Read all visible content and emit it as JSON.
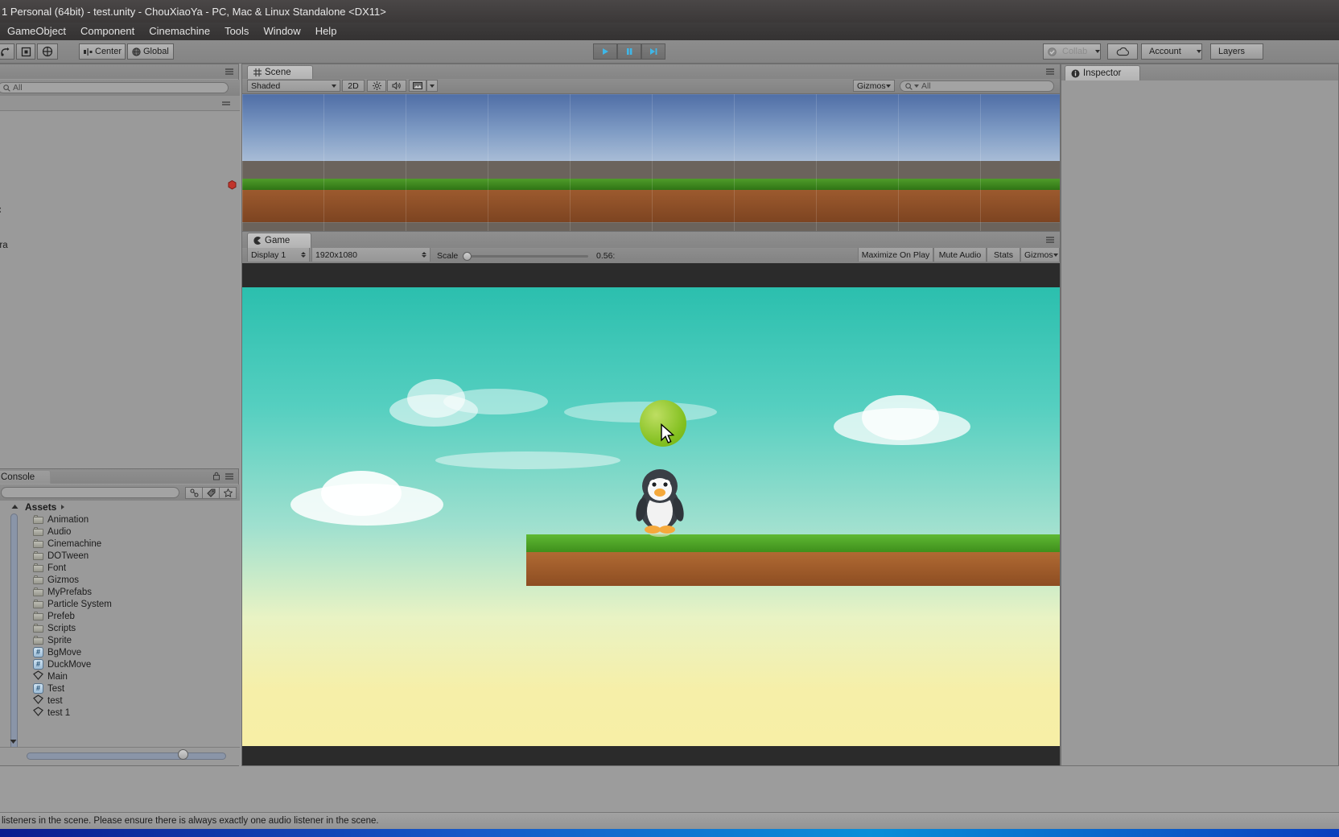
{
  "window": {
    "title": "1 Personal (64bit) - test.unity - ChouXiaoYa - PC, Mac & Linux Standalone <DX11>"
  },
  "menubar": {
    "items": [
      {
        "label": "GameObject"
      },
      {
        "label": "Component"
      },
      {
        "label": "Cinemachine"
      },
      {
        "label": "Tools"
      },
      {
        "label": "Window"
      },
      {
        "label": "Help"
      }
    ]
  },
  "toolbar": {
    "pivot_label": "Center",
    "space_label": "Global",
    "play_label": "play-button",
    "pause_label": "pause-button",
    "step_label": "step-button",
    "collab_label": "Collab",
    "cloud_label": "cloud-button",
    "account_label": "Account",
    "layers_label": "Layers"
  },
  "inspector": {
    "tab_label": "Inspector"
  },
  "scene": {
    "tab_label": "Scene",
    "draw_mode": "Shaded",
    "mode_2d": "2D",
    "gizmos_label": "Gizmos",
    "search_placeholder": "All"
  },
  "game": {
    "tab_label": "Game",
    "display": "Display 1",
    "resolution": "1920x1080",
    "scale_label": "Scale",
    "scale_value": "0.56:",
    "maximize_label": "Maximize On Play",
    "mute_label": "Mute Audio",
    "stats_label": "Stats",
    "gizmos_label": "Gizmos"
  },
  "console": {
    "tab_label": "Console",
    "search_placeholder": ""
  },
  "project": {
    "root_label": "Assets",
    "items": [
      {
        "label": "Animation",
        "kind": "folder"
      },
      {
        "label": "Audio",
        "kind": "folder"
      },
      {
        "label": "Cinemachine",
        "kind": "folder"
      },
      {
        "label": "DOTween",
        "kind": "folder"
      },
      {
        "label": "Font",
        "kind": "folder"
      },
      {
        "label": "Gizmos",
        "kind": "folder"
      },
      {
        "label": "MyPrefabs",
        "kind": "folder"
      },
      {
        "label": "Particle System",
        "kind": "folder"
      },
      {
        "label": "Prefeb",
        "kind": "folder"
      },
      {
        "label": "Scripts",
        "kind": "folder"
      },
      {
        "label": "Sprite",
        "kind": "folder"
      },
      {
        "label": "BgMove",
        "kind": "script"
      },
      {
        "label": "DuckMove",
        "kind": "script"
      },
      {
        "label": "Main",
        "kind": "scene"
      },
      {
        "label": "Test",
        "kind": "script"
      },
      {
        "label": "test",
        "kind": "scene"
      },
      {
        "label": "test 1",
        "kind": "scene"
      }
    ]
  },
  "hierarchy": {
    "search_placeholder": "All",
    "items": [
      {
        "label": ""
      },
      {
        "label": "era"
      }
    ]
  },
  "status": {
    "message": "listeners in the scene. Please ensure there is always exactly one audio listener in the scene."
  },
  "colors": {
    "chrome": "#9a9a9a",
    "title_bar": "#3f3c3c",
    "tab_active": "#bdbdbd",
    "game_sky_top": "#2bbfae",
    "game_sky_bottom": "#f7efa6",
    "grass": "#4f9c2a",
    "dirt": "#9c5a2e",
    "ball": "#8ec421",
    "taskbar": "#1659c8"
  }
}
